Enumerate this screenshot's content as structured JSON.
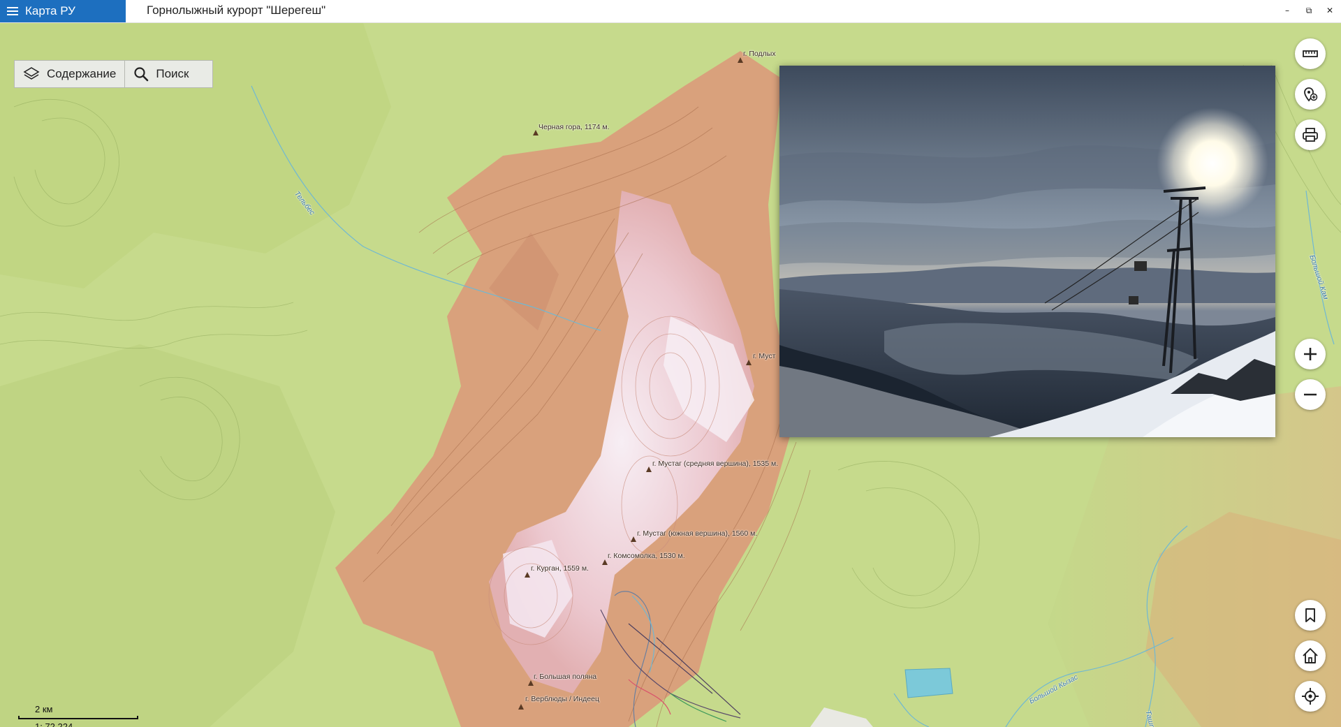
{
  "app": {
    "name": "Карта РУ"
  },
  "window": {
    "title": "Горнолыжный курорт \"Шерегеш\"",
    "minimize": "–",
    "restore": "⧉",
    "close": "✕"
  },
  "toolbar": {
    "contents_label": "Содержание",
    "search_label": "Поиск"
  },
  "map": {
    "peaks": [
      {
        "label": "г. Подлых"
      },
      {
        "label": "Черная гора, 1174 м."
      },
      {
        "label": "г. Муст"
      },
      {
        "label": "г. Мустаг (средняя вершина), 1535 м."
      },
      {
        "label": "г. Мустаг (южная вершина), 1560 м."
      },
      {
        "label": "г. Комсомолка, 1530 м."
      },
      {
        "label": "г. Курган, 1559 м."
      },
      {
        "label": "г. Большая поляна"
      },
      {
        "label": "г. Верблюды / Индеец"
      }
    ],
    "rivers": [
      {
        "label": "Тельбес"
      },
      {
        "label": "Большой Кам"
      },
      {
        "label": "Большой Кызас"
      },
      {
        "label": "Таштаг"
      }
    ],
    "colors": {
      "lowland": "#c5d98a",
      "forest": "#b9cf78",
      "slope": "#d9a07c",
      "alpine": "#efd5da",
      "water": "#7cc9d9"
    }
  },
  "scale": {
    "distance": "2 км",
    "ratio": "1: 72,224"
  },
  "controls": {
    "right_top": [
      "ruler-icon",
      "add-location-icon",
      "print-icon"
    ],
    "zoom": [
      "zoom-in-icon",
      "zoom-out-icon"
    ],
    "right_bottom": [
      "bookmark-icon",
      "home-icon",
      "locate-icon"
    ]
  }
}
